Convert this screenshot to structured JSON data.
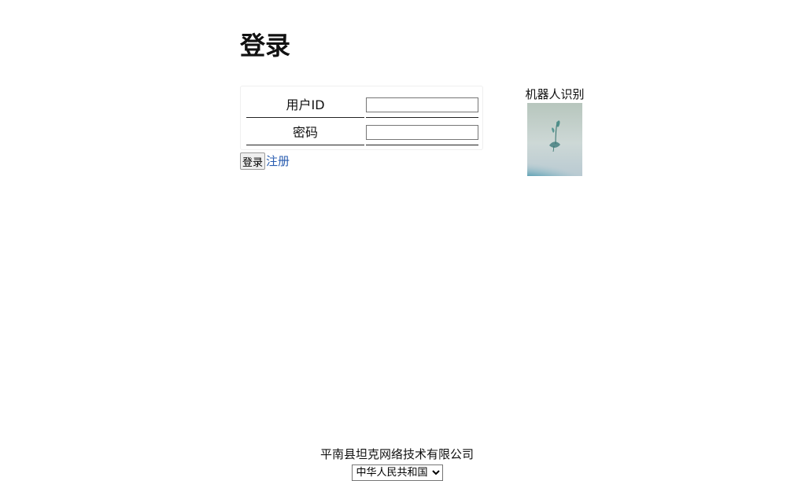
{
  "page": {
    "title": "登录"
  },
  "form": {
    "user_id_label": "用户ID",
    "user_id_value": "",
    "password_label": "密码",
    "password_value": "",
    "login_button": "登录",
    "register_link": "注册"
  },
  "captcha": {
    "label": "机器人识别"
  },
  "footer": {
    "company": "平南县坦克网络技术有限公司",
    "country_selected": "中华人民共和国"
  },
  "colors": {
    "link": "#2a5db0"
  }
}
